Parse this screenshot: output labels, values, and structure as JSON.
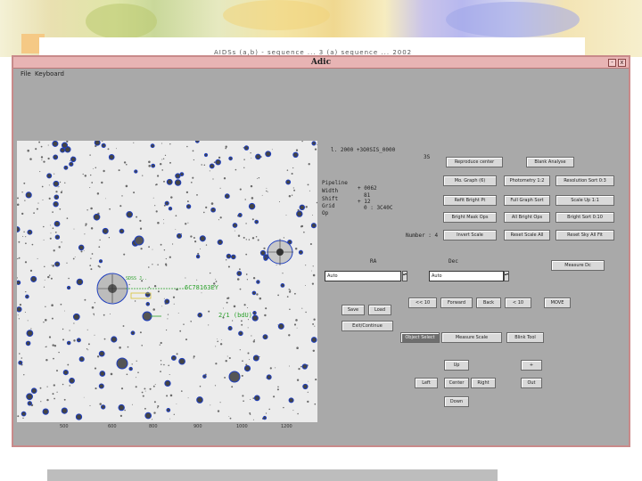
{
  "slide": {
    "title": "AIDSs (a,b) - sequence ...  3 (a) sequence  ...  2002"
  },
  "window": {
    "title": "Adic",
    "controls": {
      "minimize": "-",
      "close": "x"
    },
    "menu": [
      "File",
      "Keyboard"
    ]
  },
  "sky": {
    "labels": {
      "target_a": "SDSS J..",
      "target_b": "6C78163EY",
      "target_c": "2/1 (bdU)"
    },
    "axis_ticks": [
      "500",
      "600",
      "800",
      "900",
      "1000",
      "1200"
    ]
  },
  "panel": {
    "object_id": "l. 2000  +3O0SIS_0000",
    "object_sub": "3S",
    "params": [
      {
        "name": "Pipeline",
        "value": ""
      },
      {
        "name": "Width",
        "value": "+ 0062"
      },
      {
        "name": "Shift",
        "value": "81"
      },
      {
        "name": "Grid",
        "value": "+ 12"
      },
      {
        "name": "Op",
        "value": "0 : 3C40C"
      }
    ],
    "buttons_row1": [
      "Reproduce center",
      "Blank Analyse"
    ],
    "buttons_grid": [
      [
        "Mo. Graph (6)",
        "Photometry 1:2",
        "Resolution Sort 0:3"
      ],
      [
        "Refit Bright Pt",
        "Full Graph Sort",
        "Scale Up 1:1"
      ],
      [
        "Bright Mask Ops",
        "All Bright Ops",
        "Bright Sort 0:10"
      ],
      [
        "Invert Scale",
        "Reset Scale All",
        "Reset Sky All Fit"
      ]
    ],
    "num_label": "Number : 4",
    "ra_label": "RA",
    "dec_label": "Dec",
    "ra_value": "Auto",
    "dec_value": "Auto",
    "next_button": "Measure Dc",
    "nav_row": [
      "<< 10",
      "Forward",
      "Back",
      "< 10",
      "MOVE"
    ],
    "save_button": "Save",
    "load_button": "Load",
    "exit_button": "Exit/Continue",
    "mode_buttons": [
      "Object Select",
      "Measure Scale",
      "Blink Tool"
    ],
    "dir": {
      "up": "Up",
      "left": "Left",
      "center": "Center",
      "right": "Right",
      "down": "Down"
    },
    "zoom": {
      "in": "+",
      "out": "Out"
    }
  },
  "colors": {
    "window_border": "#c98a8a",
    "titlebar": "#e8b4b4",
    "panel_bg": "#a9a9a9",
    "circle": "#1f3fbf",
    "label_green": "#2aa02a",
    "label_yellow": "#d8c233"
  }
}
